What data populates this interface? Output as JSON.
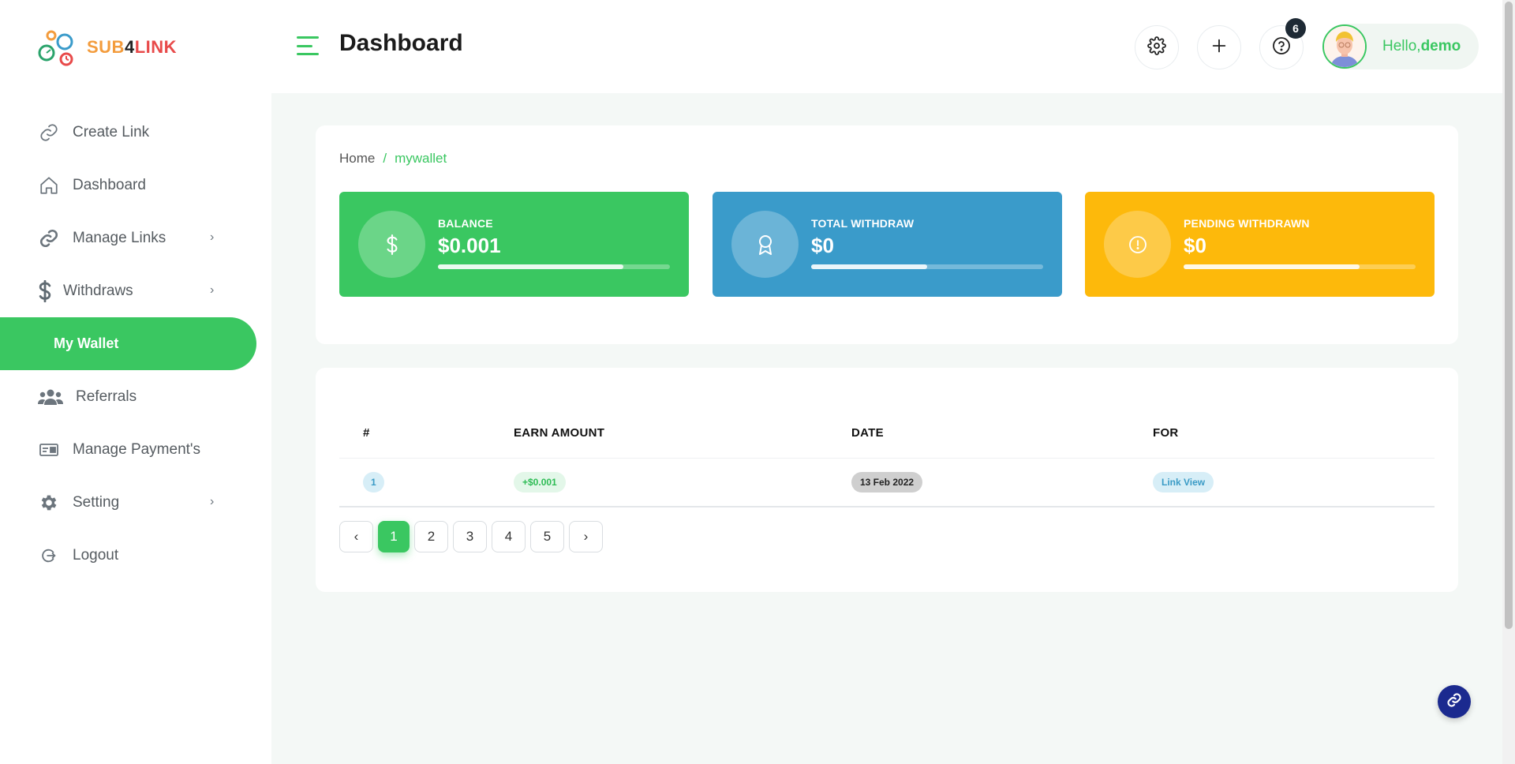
{
  "brand": {
    "name_part1": "SUB",
    "name_part2": "4",
    "name_part3": "LINK"
  },
  "sidebar": {
    "items": [
      {
        "label": "Create Link",
        "icon": "link-icon",
        "has_submenu": false
      },
      {
        "label": "Dashboard",
        "icon": "home-icon",
        "has_submenu": false
      },
      {
        "label": "Manage Links",
        "icon": "chain-icon",
        "has_submenu": true
      },
      {
        "label": "Withdraws",
        "icon": "dollar-icon",
        "has_submenu": true
      },
      {
        "label": "My Wallet",
        "icon": "",
        "has_submenu": false,
        "active": true
      },
      {
        "label": "Referrals",
        "icon": "users-icon",
        "has_submenu": false
      },
      {
        "label": "Manage Payment's",
        "icon": "card-icon",
        "has_submenu": false
      },
      {
        "label": "Setting",
        "icon": "gear-icon",
        "has_submenu": true
      },
      {
        "label": "Logout",
        "icon": "logout-icon",
        "has_submenu": false
      }
    ]
  },
  "header": {
    "title": "Dashboard",
    "notification_count": "6",
    "greeting": "Hello,",
    "username": "demo"
  },
  "breadcrumb": {
    "home": "Home",
    "separator": "/",
    "current": "mywallet"
  },
  "stats": [
    {
      "label": "BALANCE",
      "value": "$0.001",
      "icon": "dollar-icon",
      "color": "#3ac761",
      "progress": 0.8
    },
    {
      "label": "TOTAL WITHDRAW",
      "value": "$0",
      "icon": "award-icon",
      "color": "#3a9bca",
      "progress": 0.5
    },
    {
      "label": "PENDING WITHDRAWN",
      "value": "$0",
      "icon": "alert-circle-icon",
      "color": "#fdb90b",
      "progress": 0.76
    }
  ],
  "table": {
    "columns": [
      "#",
      "EARN AMOUNT",
      "DATE",
      "FOR"
    ],
    "rows": [
      {
        "index": "1",
        "amount": "+$0.001",
        "date": "13 Feb 2022",
        "for": "Link View"
      }
    ]
  },
  "pagination": {
    "prev": "‹",
    "pages": [
      "1",
      "2",
      "3",
      "4",
      "5"
    ],
    "current": "1",
    "next": "›"
  },
  "colors": {
    "accent": "#3ac761",
    "background": "#f4f8f6",
    "fab": "#1b2a8f"
  }
}
